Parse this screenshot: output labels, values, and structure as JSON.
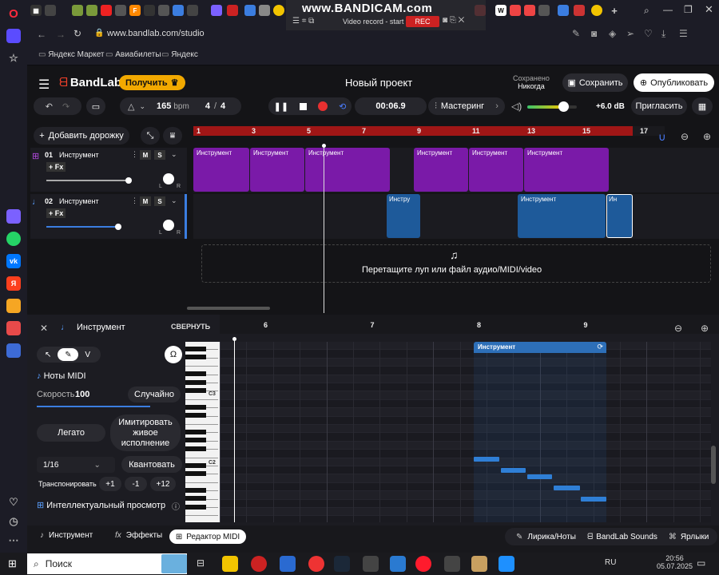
{
  "browser": {
    "url": "www.bandlab.com/studio",
    "bookmarks": [
      "Яндекс Маркет",
      "Авиабилеты",
      "Яндекс"
    ]
  },
  "bandicam": {
    "watermark": "www.BANDICAM.com",
    "video_label": "Video record - start",
    "rec_label": "REC"
  },
  "header": {
    "logo": "BandLab",
    "get_button": "Получить",
    "project_title": "Новый проект",
    "saved_label": "Сохранено",
    "saved_value": "Никогда",
    "save_button": "Сохранить",
    "publish_button": "Опубликовать"
  },
  "transport": {
    "bpm": "165",
    "bpm_unit": "bpm",
    "sig_num": "4",
    "sig_sep": "/",
    "sig_den": "4",
    "time": "00:06.9",
    "mastering": "Мастеринг",
    "volume_db": "+6.0 dB",
    "volume_level": 0.72,
    "invite": "Пригласить"
  },
  "tracks_panel": {
    "add_track": "Добавить дорожку",
    "tracks": [
      {
        "num": "01",
        "name": "Инструмент",
        "m": "M",
        "s": "S",
        "fx": "+ Fx",
        "l": "L",
        "r": "R"
      },
      {
        "num": "02",
        "name": "Инструмент",
        "m": "M",
        "s": "S",
        "fx": "+ Fx",
        "l": "L",
        "r": "R"
      }
    ]
  },
  "ruler": {
    "marks": [
      "1",
      "3",
      "5",
      "7",
      "9",
      "11",
      "13",
      "15",
      "17"
    ]
  },
  "clips": {
    "label": "Инструмент",
    "short_label": "Инстру",
    "tiny_label": "Ин"
  },
  "drop_zone": "Перетащите луп или файл аудио/MIDI/video",
  "editor": {
    "title": "Инструмент",
    "collapse": "СВЕРНУТЬ",
    "ruler_marks": [
      "6",
      "7",
      "8",
      "9"
    ],
    "clip_label": "Инструмент",
    "v_label": "V",
    "midi_notes": "Ноты MIDI",
    "velocity_label": "Скорость",
    "velocity_value": "100",
    "random": "Случайно",
    "legato": "Легато",
    "humanize": "Имитировать живое исполнение",
    "quantize_value": "1/16",
    "quantize": "Квантовать",
    "transpose": "Транспонировать",
    "t_plus1": "+1",
    "t_minus1": "-1",
    "t_plus12": "+12",
    "smart_view": "Интеллектуальный просмотр",
    "key_c3": "C3",
    "key_c2": "C2"
  },
  "bottom_tabs": {
    "instrument": "Инструмент",
    "effects": "Эффекты",
    "midi_editor": "Редактор MIDI",
    "lyrics": "Лирика/Ноты",
    "sounds": "BandLab Sounds",
    "labels": "Ярлыки"
  },
  "taskbar": {
    "search": "Поиск",
    "lang": "RU",
    "time": "20:56",
    "date": "05.07.2025"
  },
  "colors": {
    "track1": "#7a1aa8",
    "track2": "#1e5a9a",
    "ruler": "#a01616",
    "accent": "#f2a900",
    "record": "#e83030"
  }
}
